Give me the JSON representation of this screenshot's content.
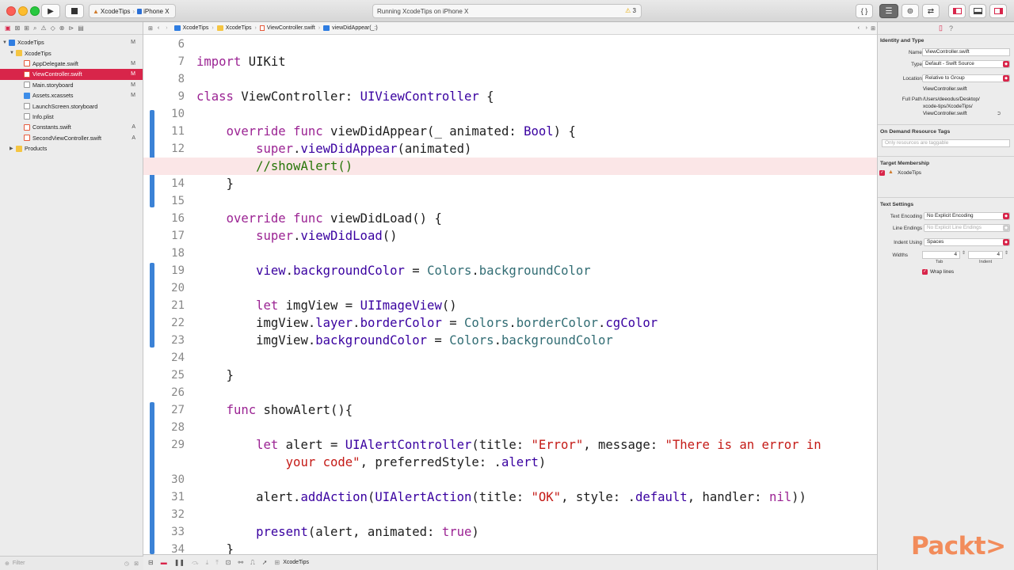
{
  "toolbar": {
    "scheme_target": "XcodeTips",
    "device": "iPhone X",
    "status": "Running XcodeTips on iPhone X",
    "warning_count": "3"
  },
  "navigator": {
    "items": [
      {
        "label": "XcodeTips",
        "badge": "M",
        "kind": "project"
      },
      {
        "label": "XcodeTips",
        "badge": "",
        "kind": "group"
      },
      {
        "label": "AppDelegate.swift",
        "badge": "M",
        "kind": "swift"
      },
      {
        "label": "ViewController.swift",
        "badge": "M",
        "kind": "swift",
        "selected": true
      },
      {
        "label": "Main.storyboard",
        "badge": "M",
        "kind": "storyboard"
      },
      {
        "label": "Assets.xcassets",
        "badge": "M",
        "kind": "assets"
      },
      {
        "label": "LaunchScreen.storyboard",
        "badge": "",
        "kind": "storyboard"
      },
      {
        "label": "Info.plist",
        "badge": "",
        "kind": "plist"
      },
      {
        "label": "Constants.swift",
        "badge": "A",
        "kind": "swift"
      },
      {
        "label": "SecondViewController.swift",
        "badge": "A",
        "kind": "swift"
      },
      {
        "label": "Products",
        "badge": "",
        "kind": "group"
      }
    ],
    "filter_placeholder": "Filter"
  },
  "jumpbar": {
    "crumbs": [
      "XcodeTips",
      "XcodeTips",
      "ViewController.swift",
      "viewDidAppear(_:)"
    ]
  },
  "editor": {
    "current_line": "13",
    "lines": [
      {
        "n": "6"
      },
      {
        "n": "7"
      },
      {
        "n": "8"
      },
      {
        "n": "9"
      },
      {
        "n": "10"
      },
      {
        "n": "11"
      },
      {
        "n": "12"
      },
      {
        "n": "13"
      },
      {
        "n": "14"
      },
      {
        "n": "15"
      },
      {
        "n": "16"
      },
      {
        "n": "17"
      },
      {
        "n": "18"
      },
      {
        "n": "19"
      },
      {
        "n": "20"
      },
      {
        "n": "21"
      },
      {
        "n": "22"
      },
      {
        "n": "23"
      },
      {
        "n": "24"
      },
      {
        "n": "25"
      },
      {
        "n": "26"
      },
      {
        "n": "27"
      },
      {
        "n": "28"
      },
      {
        "n": "29"
      },
      {
        "n": ""
      },
      {
        "n": "30"
      },
      {
        "n": "31"
      },
      {
        "n": "32"
      },
      {
        "n": "33"
      },
      {
        "n": "34"
      }
    ],
    "code": {
      "l7a": "import",
      "l7b": " UIKit",
      "l9a": "class",
      "l9b": " ViewController: ",
      "l9c": "UIViewController",
      "l9d": " {",
      "l11a": "override",
      "l11b": " ",
      "l11c": "func",
      "l11d": " viewDidAppear(_ animated: ",
      "l11e": "Bool",
      "l11f": ") {",
      "l12a": "super",
      "l12b": ".",
      "l12c": "viewDidAppear",
      "l12d": "(animated)",
      "l13a": "//showAlert()",
      "l14a": "}",
      "l16a": "override",
      "l16b": " ",
      "l16c": "func",
      "l16d": " viewDidLoad() {",
      "l17a": "super",
      "l17b": ".",
      "l17c": "viewDidLoad",
      "l17d": "()",
      "l19a": "view",
      "l19b": ".",
      "l19c": "backgroundColor",
      "l19d": " = ",
      "l19e": "Colors",
      "l19f": ".",
      "l19g": "backgroundColor",
      "l21a": "let",
      "l21b": " imgView = ",
      "l21c": "UIImageView",
      "l21d": "()",
      "l22a": "imgView.",
      "l22b": "layer",
      "l22c": ".",
      "l22d": "borderColor",
      "l22e": " = ",
      "l22f": "Colors",
      "l22g": ".",
      "l22h": "borderColor",
      "l22i": ".",
      "l22j": "cgColor",
      "l23a": "imgView.",
      "l23b": "backgroundColor",
      "l23c": " = ",
      "l23d": "Colors",
      "l23e": ".",
      "l23f": "backgroundColor",
      "l25a": "}",
      "l27a": "func",
      "l27b": " showAlert(){",
      "l29a": "let",
      "l29b": " alert = ",
      "l29c": "UIAlertController",
      "l29d": "(title: ",
      "l29e": "\"Error\"",
      "l29f": ", message: ",
      "l29g": "\"There is an error in",
      "l29h": "your code\"",
      "l29i": ", preferredStyle: .",
      "l29j": "alert",
      "l29k": ")",
      "l31a": "alert.",
      "l31b": "addAction",
      "l31c": "(",
      "l31d": "UIAlertAction",
      "l31e": "(title: ",
      "l31f": "\"OK\"",
      "l31g": ", style: .",
      "l31h": "default",
      "l31i": ", handler: ",
      "l31j": "nil",
      "l31k": "))",
      "l33a": "present",
      "l33b": "(alert, animated: ",
      "l33c": "true",
      "l33d": ")",
      "l34a": "}"
    }
  },
  "debug": {
    "target": "XcodeTips"
  },
  "inspector": {
    "identity_header": "Identity and Type",
    "name_label": "Name",
    "name_value": "ViewController.swift",
    "type_label": "Type",
    "type_value": "Default - Swift Source",
    "location_label": "Location",
    "location_value": "Relative to Group",
    "location_file": "ViewController.swift",
    "fullpath_label": "Full Path",
    "fullpath_1": "/Users/deeodus/Desktop/",
    "fullpath_2": "xcode-tips/XcodeTips/",
    "fullpath_3": "ViewController.swift",
    "odr_header": "On Demand Resource Tags",
    "odr_placeholder": "Only resources are taggable",
    "membership_header": "Target Membership",
    "membership_target": "XcodeTips",
    "text_header": "Text Settings",
    "encoding_label": "Text Encoding",
    "encoding_value": "No Explicit Encoding",
    "endings_label": "Line Endings",
    "endings_value": "No Explicit Line Endings",
    "indent_label": "Indent Using",
    "indent_value": "Spaces",
    "widths_label": "Widths",
    "tab_value": "4",
    "indent_width_value": "4",
    "tab_caption": "Tab",
    "indent_caption": "Indent",
    "wrap_label": "Wrap lines"
  },
  "brand": {
    "text": "Packt>"
  },
  "colors": {
    "accent": "#d8254a",
    "keyword": "#9b2393",
    "type": "#3900a0",
    "property": "#326d74",
    "string": "#c41a16",
    "comment": "#267507",
    "change_bar": "#3b82d6"
  }
}
